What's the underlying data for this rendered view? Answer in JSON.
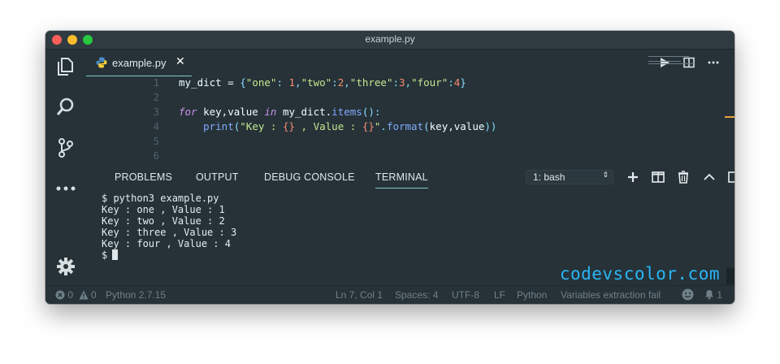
{
  "window": {
    "title": "example.py"
  },
  "editor": {
    "tab": {
      "label": "example.py",
      "close": "✕"
    },
    "lines": [
      {
        "num": "1",
        "tokens": [
          [
            "var",
            "my_dict"
          ],
          [
            "var",
            " = "
          ],
          [
            "punc",
            "{"
          ],
          [
            "str",
            "\"one\""
          ],
          [
            "punc",
            ": "
          ],
          [
            "num",
            "1"
          ],
          [
            "punc",
            ","
          ],
          [
            "str",
            "\"two\""
          ],
          [
            "punc",
            ":"
          ],
          [
            "num",
            "2"
          ],
          [
            "punc",
            ","
          ],
          [
            "str",
            "\"three\""
          ],
          [
            "punc",
            ":"
          ],
          [
            "num",
            "3"
          ],
          [
            "punc",
            ","
          ],
          [
            "str",
            "\"four\""
          ],
          [
            "punc",
            ":"
          ],
          [
            "num",
            "4"
          ],
          [
            "punc",
            "}"
          ]
        ]
      },
      {
        "num": "2",
        "tokens": []
      },
      {
        "num": "3",
        "tokens": [
          [
            "kw",
            "for"
          ],
          [
            "var",
            " key,value "
          ],
          [
            "kw",
            "in"
          ],
          [
            "var",
            " my_dict."
          ],
          [
            "fn",
            "items"
          ],
          [
            "punc",
            "():"
          ]
        ]
      },
      {
        "num": "4",
        "tokens": [
          [
            "var",
            "    "
          ],
          [
            "fn",
            "print"
          ],
          [
            "punc",
            "("
          ],
          [
            "str",
            "\"Key : "
          ],
          [
            "num",
            "{}"
          ],
          [
            "str",
            " , Value : "
          ],
          [
            "num",
            "{}"
          ],
          [
            "str",
            "\""
          ],
          [
            "punc",
            "."
          ],
          [
            "fn",
            "format"
          ],
          [
            "punc",
            "("
          ],
          [
            "var",
            "key,value"
          ],
          [
            "punc",
            "))"
          ]
        ]
      },
      {
        "num": "5",
        "tokens": []
      },
      {
        "num": "6",
        "tokens": []
      }
    ]
  },
  "panel": {
    "tabs": [
      "PROBLEMS",
      "OUTPUT",
      "DEBUG CONSOLE",
      "TERMINAL"
    ],
    "active_tab": "TERMINAL",
    "terminal_select": "1: bash",
    "terminal_lines": [
      "$ python3 example.py",
      "Key : one , Value : 1",
      "Key : two , Value : 2",
      "Key : three , Value : 3",
      "Key : four , Value : 4",
      "$"
    ],
    "watermark": "codevscolor.com"
  },
  "status": {
    "errors": "0",
    "warnings": "0",
    "interpreter": "Python 2.7.15",
    "position": "Ln 7, Col 1",
    "spaces": "Spaces: 4",
    "encoding": "UTF-8",
    "eol": "LF",
    "language": "Python",
    "message": "Variables extraction fail",
    "notifications": "1"
  },
  "colors": {
    "background": "#263238",
    "accent": "#80cbc4",
    "string": "#c3e88d",
    "number": "#f78c6c",
    "keyword": "#c792ea",
    "function": "#82aaff",
    "watermark": "#29b6f6"
  }
}
